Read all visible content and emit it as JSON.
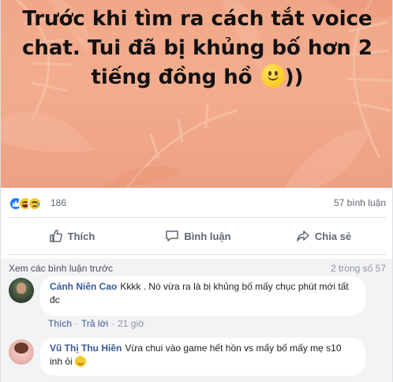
{
  "post": {
    "banner_line1": "Trước khi tìm ra cách tắt voice",
    "banner_line2": "chat. Tui đã bị khủng bố hơn 2",
    "banner_line3": "tiếng đồng hồ",
    "banner_tail": "))",
    "banner_emoji": "slightly-smiling-face-icon",
    "banner_bg_color": "#f0a788"
  },
  "stats": {
    "reaction_count": "186",
    "comment_count": "57 bình luận",
    "reactions": [
      "like-icon",
      "haha-icon",
      "sad-icon"
    ]
  },
  "actions": {
    "like_label": "Thích",
    "comment_label": "Bình luận",
    "share_label": "Chia sẻ"
  },
  "comments_section": {
    "view_previous": "Xem các bình luận trước",
    "count_label": "2 trong số 57",
    "items": [
      {
        "author": "Cảnh Niên Cao",
        "text": "Kkkk . Nó vừa ra là bị khủng bố mấy chục phút mới tất đc",
        "like": "Thích",
        "reply": "Trả lời",
        "time": "21 giờ"
      },
      {
        "author": "Vũ Thị Thu Hiền",
        "text": "Vừa chui vào game hết hồn vs mấy bố mấy mẹ s10 inh ỏi",
        "emoji": "smile-icon"
      }
    ]
  },
  "colors": {
    "link": "#385898",
    "like_blue": "#2078f4",
    "muted": "#606770",
    "comment_bg": "#f2f3f5"
  }
}
